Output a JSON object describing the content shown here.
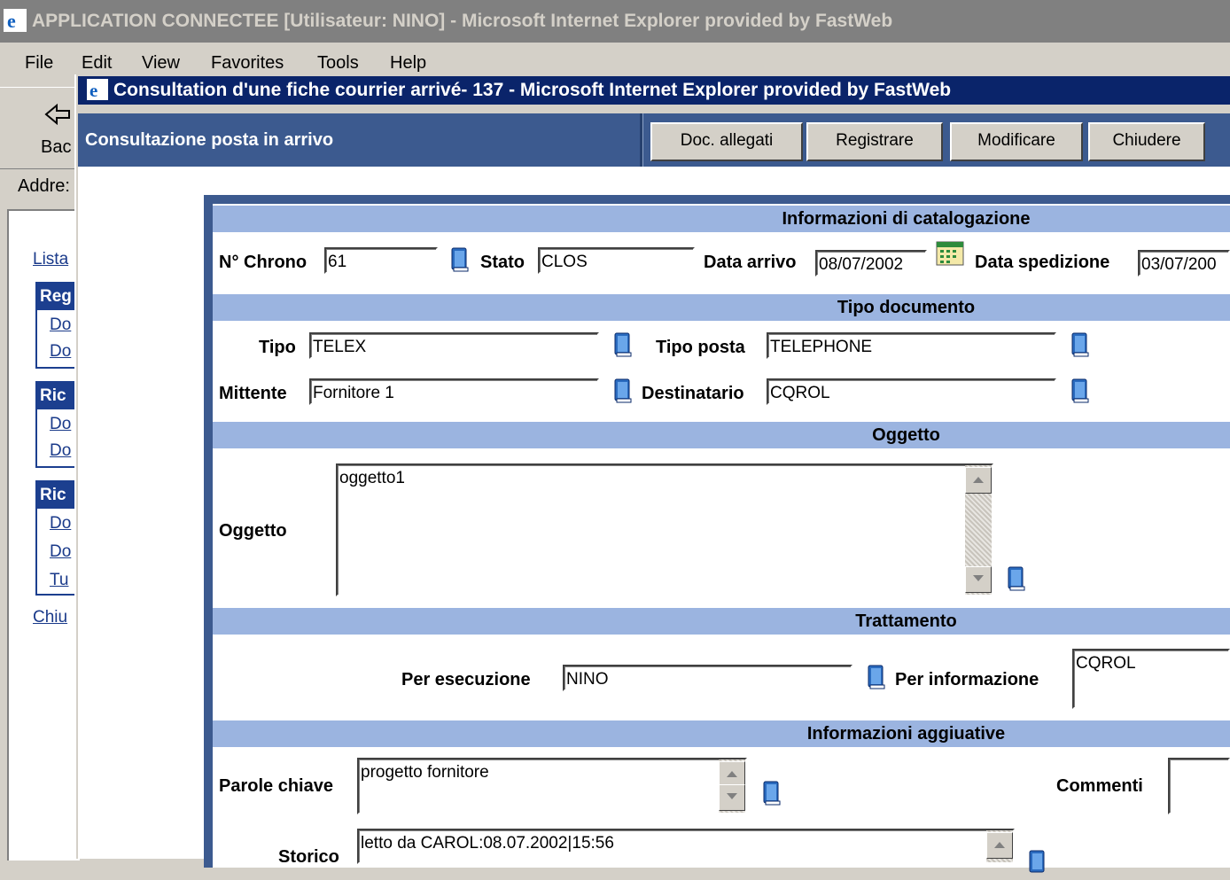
{
  "outer_window": {
    "title": "APPLICATION CONNECTEE [Utilisateur: NINO] - Microsoft Internet Explorer provided by FastWeb",
    "menu": [
      "File",
      "Edit",
      "View",
      "Favorites",
      "Tools",
      "Help"
    ],
    "toolbar_back": "Bac",
    "address_label": "Addre:",
    "left_links": {
      "lista": "Lista",
      "box1_header": "Reg",
      "box1_items": [
        "Do",
        "Do"
      ],
      "box2_header": "Ric",
      "box2_items": [
        "Do",
        "Do"
      ],
      "box3_header": "Ric",
      "box3_items": [
        "Do",
        "Do",
        "Tu"
      ],
      "chiudi": "Chiu"
    }
  },
  "popup": {
    "title": "Consultation d'une fiche courrier arrivé- 137 - Microsoft Internet Explorer provided by FastWeb",
    "header_title": "Consultazione posta in arrivo",
    "buttons": {
      "doc_allegati": "Doc. allegati",
      "registrare": "Registrare",
      "modificare": "Modificare",
      "chiudere": "Chiudere"
    }
  },
  "form": {
    "sections": {
      "catalog": "Informazioni di catalogazione",
      "tipo_documento": "Tipo documento",
      "oggetto": "Oggetto",
      "trattamento": "Trattamento",
      "info_aggiuntive": "Informazioni aggiuative"
    },
    "chrono": {
      "label": "N° Chrono",
      "value": "61"
    },
    "stato": {
      "label": "Stato",
      "value": "CLOS"
    },
    "data_arrivo": {
      "label": "Data arrivo",
      "value": "08/07/2002"
    },
    "data_spedizione": {
      "label": "Data spedizione",
      "value": "03/07/200"
    },
    "tipo": {
      "label": "Tipo",
      "value": "TELEX"
    },
    "tipo_posta": {
      "label": "Tipo posta",
      "value": "TELEPHONE"
    },
    "mittente": {
      "label": "Mittente",
      "value": "Fornitore 1"
    },
    "destinatario": {
      "label": "Destinatario",
      "value": "CQROL"
    },
    "oggetto": {
      "label": "Oggetto",
      "value": "oggetto1"
    },
    "per_esecuzione": {
      "label": "Per esecuzione",
      "value": "NINO"
    },
    "per_informazione": {
      "label": "Per informazione",
      "value": "CQROL"
    },
    "parole_chiave": {
      "label": "Parole chiave",
      "value": "progetto fornitore"
    },
    "commenti": {
      "label": "Commenti",
      "value": ""
    },
    "storico": {
      "label": "Storico",
      "value": "letto da  CAROL:08.07.2002|15:56"
    }
  },
  "colors": {
    "popup_titlebar": "#0a246a",
    "header_bar": "#3c5a8f",
    "section_bar": "#9bb4e0",
    "link": "#1a3a8a"
  },
  "icons": [
    "ie-logo-icon",
    "back-arrow-icon",
    "lookup-book-icon",
    "calendar-icon",
    "scroll-up-icon",
    "scroll-down-icon"
  ]
}
